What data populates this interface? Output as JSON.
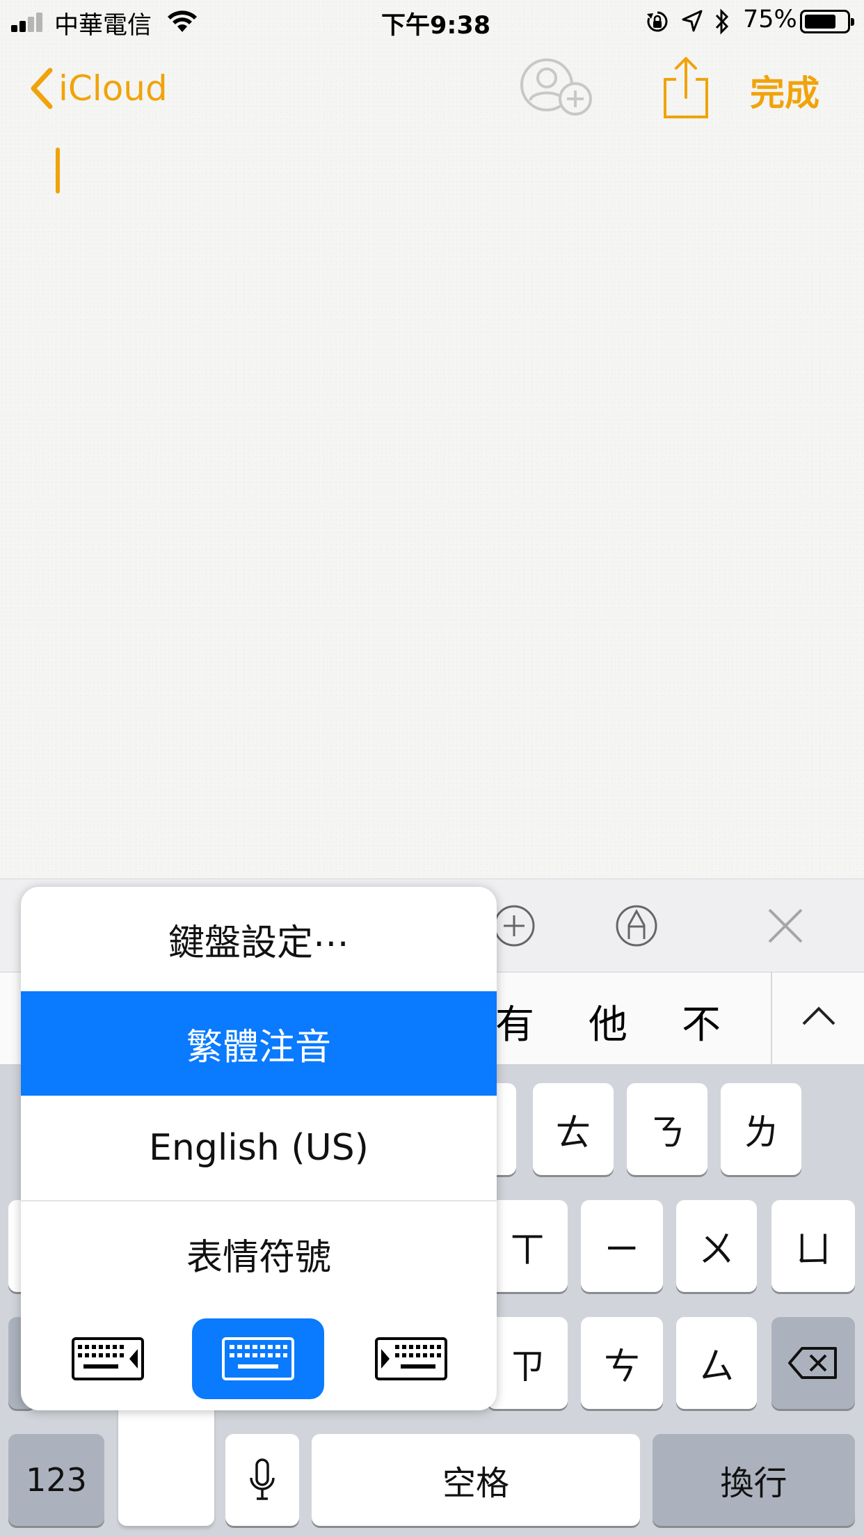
{
  "status_bar": {
    "carrier": "中華電信",
    "time": "下午9:38",
    "battery_percent": "75%",
    "battery_level": 0.75
  },
  "nav": {
    "back_label": "iCloud",
    "done_label": "完成",
    "accent_color": "#f0a30a"
  },
  "candidates": [
    "有",
    "他",
    "不"
  ],
  "keyboard": {
    "row1": [
      "ㄊ",
      "ㄋ",
      "ㄌ"
    ],
    "row2": [
      "ㄒ",
      "ㄧ",
      "ㄨ",
      "ㄩ"
    ],
    "row3": [
      "ㄗ",
      "ㄘ",
      "ㄙ"
    ],
    "numbers_label": "123",
    "space_label": "空格",
    "return_label": "換行"
  },
  "keyboard_menu": {
    "settings": "鍵盤設定⋯",
    "selected_accent": "#0a7afe",
    "items": [
      "繁體注音",
      "English (US)",
      "表情符號"
    ],
    "selected_index": 0,
    "selected_layout": "center"
  }
}
